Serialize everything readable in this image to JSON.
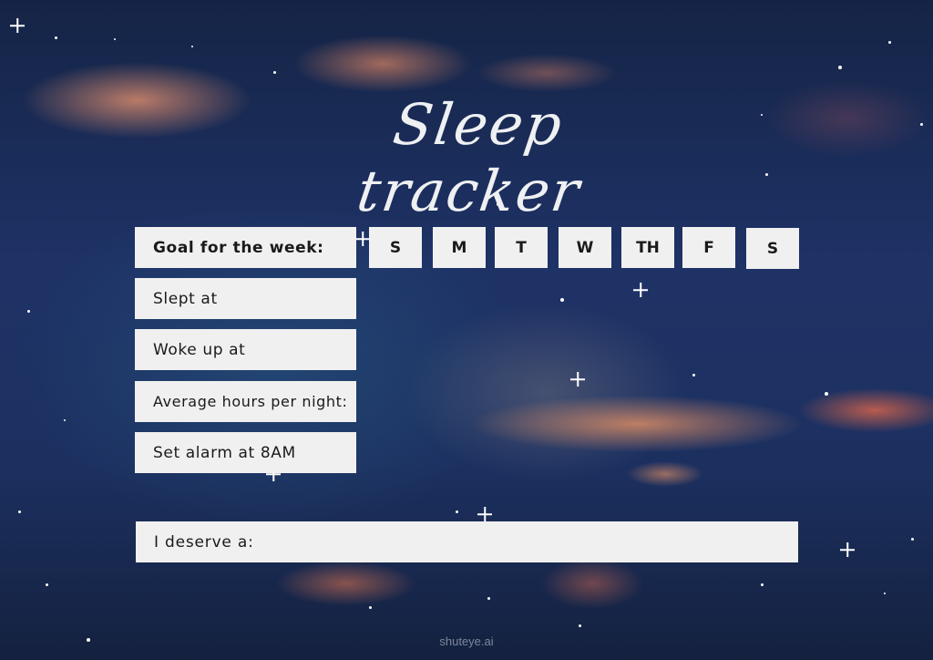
{
  "title": "Sleep tracker",
  "goal_label": "Goal for the week:",
  "days": [
    "S",
    "M",
    "T",
    "W",
    "TH",
    "F",
    "S"
  ],
  "rows": {
    "slept": "Slept at",
    "woke": "Woke up at",
    "average": "Average hours per night:",
    "alarm": "Set alarm at 8AM"
  },
  "reward_label": "I deserve a:",
  "watermark": "shuteye.ai",
  "colors": {
    "box": "#f0f0f0",
    "text": "#1a1a1a",
    "title": "#eef0f2",
    "sky": "#1e3266",
    "cloud": "#f0966e"
  }
}
